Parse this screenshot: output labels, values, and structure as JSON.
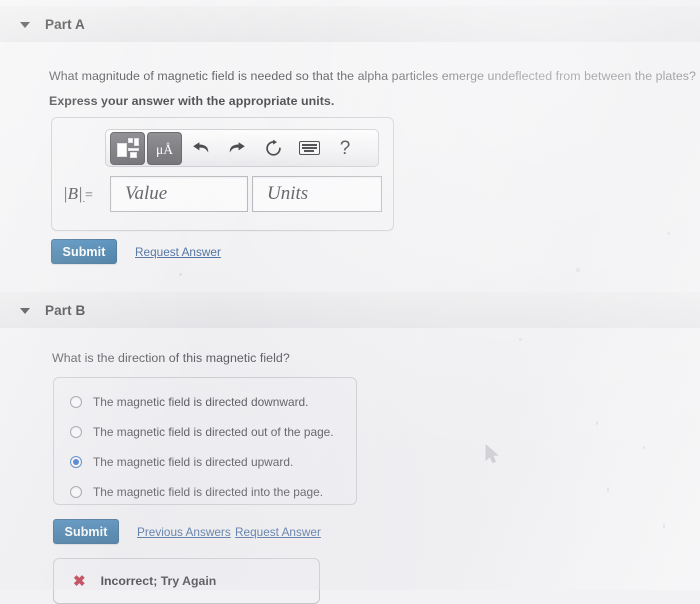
{
  "parts": {
    "a": {
      "header_label": "Part A",
      "question": "What magnitude of magnetic field is needed so that the alpha particles emerge undeflected from between the plates?",
      "instruction": "Express your answer with the appropriate units.",
      "answer_label": "|B|",
      "equals": "=",
      "value_placeholder": "Value",
      "units_placeholder": "Units",
      "submit_label": "Submit",
      "request_answer_label": "Request Answer",
      "toolbar": {
        "template_icon": "template-matrix-icon",
        "units_icon_label": "μÅ",
        "undo_icon": "undo-arrow-icon",
        "redo_icon": "redo-arrow-icon",
        "reset_icon": "reset-circular-arrow-icon",
        "keyboard_icon": "keyboard-icon",
        "help_label": "?"
      }
    },
    "b": {
      "header_label": "Part B",
      "question": "What is the direction of this magnetic field?",
      "choices": [
        {
          "label": "The magnetic field is directed downward.",
          "selected": false
        },
        {
          "label": "The magnetic field is directed out of the page.",
          "selected": false
        },
        {
          "label": "The magnetic field is directed upward.",
          "selected": true
        },
        {
          "label": "The magnetic field is directed into the page.",
          "selected": false
        }
      ],
      "submit_label": "Submit",
      "previous_answers_label": "Previous Answers",
      "request_answer_label": "Request Answer",
      "feedback": {
        "icon": "x-mark-icon",
        "symbol": "✖",
        "text": "Incorrect; Try Again",
        "color": "#b5172c"
      }
    }
  },
  "colors": {
    "submit_button": "#1b6398",
    "link": "#25518c",
    "selected_radio": "#1556c9",
    "page_background": "#f2f2f4",
    "header_band": "#e7e7e9"
  }
}
